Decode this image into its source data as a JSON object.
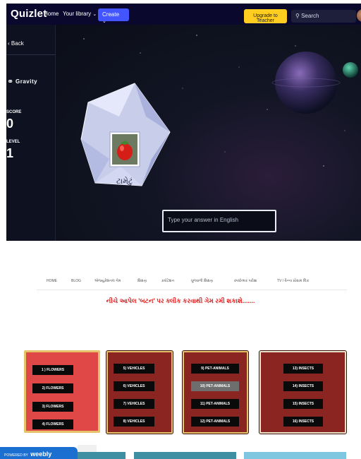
{
  "quizlet": {
    "logo": "Quizlet",
    "nav": {
      "home": "Home",
      "library": "Your library",
      "create": "Create"
    },
    "upgrade": "Upgrade to Teacher",
    "search": "Search",
    "sidebar": {
      "back": "Back",
      "game_title": "Gravity",
      "score_label": "SCORE",
      "score": "0",
      "level_label": "LEVEL",
      "level": "1"
    },
    "asteroid_word": "ટામેટું",
    "answer_placeholder": "Type your answer in English"
  },
  "site": {
    "nav": [
      "HOME",
      "BLOG",
      "એજ્યુકેશનલ ગેમ",
      "શિક્ષણ",
      "કવોટેશન",
      "ધૂળવાળી શિક્ષણ",
      "સ્પર્ધાત્મક પરીક્ષા",
      "TV / વૈન્ના પ્રોગ્રામ લિંક"
    ],
    "heading": "નીચે આપેલ 'બટન' પર ક્લીક કરવાથી ગેમ રમી શકાશે.......",
    "panels": [
      {
        "buttons": [
          "1 ) FLOWERS",
          "2) FLOWERS",
          "3) FLOWERS",
          "4) FLOWERS"
        ]
      },
      {
        "buttons": [
          "5) VEHICLES",
          "6) VEHICLES",
          "7) VEHICLES",
          "8) VEHICLES"
        ]
      },
      {
        "buttons": [
          "9) PET-ANIMALS",
          "10) PET-ANIMALS",
          "11) PET-ANIMALS",
          "12) PET-ANIMALS"
        ]
      },
      {
        "buttons": [
          "13) INSECTS",
          "14) INSECTS",
          "15) INSECTS",
          "16) INSECTS"
        ]
      }
    ],
    "badge_prefix": "POWERED BY",
    "badge_brand": "weebly"
  },
  "colors": {
    "quizlet_nav": "#0a092d",
    "create_button": "#4255ff",
    "upgrade_button": "#ffcd1f",
    "panel_flowers": "#e04848",
    "panel_dark": "#8b2522",
    "panel_border_gold": "#e6c36a",
    "heading_red": "#e31d1d",
    "weebly_blue": "#1a6fd1"
  }
}
